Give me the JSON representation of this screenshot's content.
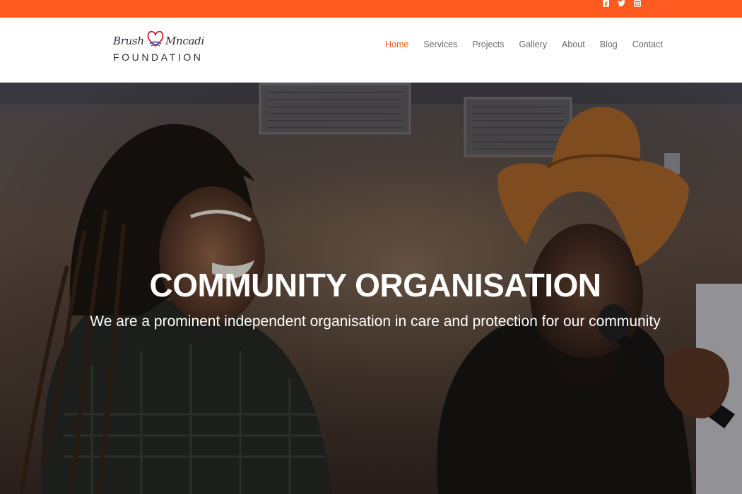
{
  "topbar": {
    "color": "#ff5a1f",
    "social_icons": [
      "facebook-icon",
      "twitter-icon",
      "instagram-icon"
    ]
  },
  "logo": {
    "script_left": "Brush",
    "script_right": "Mncadi",
    "wordmark": "FOUNDATION"
  },
  "nav": {
    "items": [
      {
        "label": "Home",
        "active": true
      },
      {
        "label": "Services",
        "active": false
      },
      {
        "label": "Projects",
        "active": false
      },
      {
        "label": "Gallery",
        "active": false
      },
      {
        "label": "About",
        "active": false
      },
      {
        "label": "Blog",
        "active": false
      },
      {
        "label": "Contact",
        "active": false
      }
    ],
    "active_color": "#ff5a1f"
  },
  "hero": {
    "title": "COMMUNITY ORGANISATION",
    "subtitle": "We are a prominent independent organisation in care and protection for our community"
  }
}
